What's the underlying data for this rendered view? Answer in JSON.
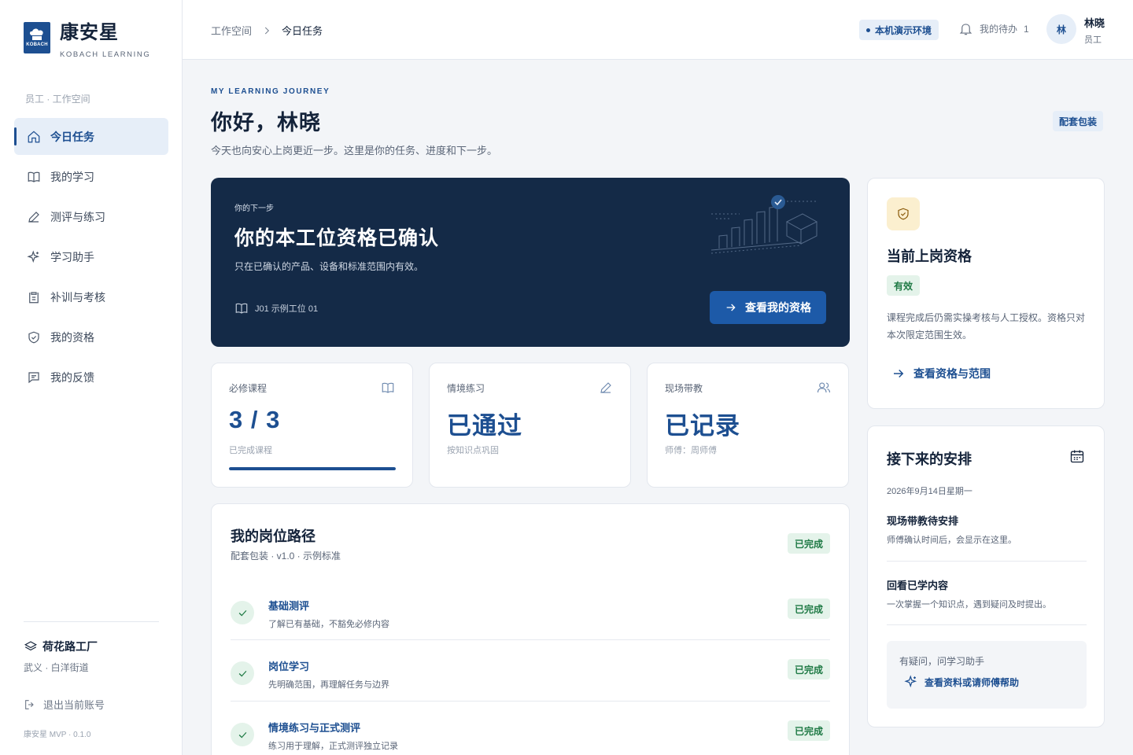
{
  "brand": {
    "title": "康安星",
    "subtitle": "KOBACH LEARNING",
    "logo_text": "KOBACH"
  },
  "sidebar": {
    "role_label": "员工 · 工作空间",
    "items": [
      {
        "label": "今日任务",
        "icon": "home-icon",
        "active": true
      },
      {
        "label": "我的学习",
        "icon": "book-icon"
      },
      {
        "label": "测评与练习",
        "icon": "pencil-icon"
      },
      {
        "label": "学习助手",
        "icon": "sparkle-icon"
      },
      {
        "label": "补训与考核",
        "icon": "clipboard-icon"
      },
      {
        "label": "我的资格",
        "icon": "shield-check-icon"
      },
      {
        "label": "我的反馈",
        "icon": "message-icon"
      }
    ],
    "factory_name": "荷花路工厂",
    "factory_location": "武义 · 白洋街道",
    "logout_label": "退出当前账号",
    "version": "康安星 MVP · 0.1.0"
  },
  "header": {
    "breadcrumb_root": "工作空间",
    "breadcrumb_current": "今日任务",
    "env_badge": "本机演示环境",
    "todo_label": "我的待办",
    "todo_count": "1",
    "avatar_initial": "林",
    "user_name": "林晓",
    "user_role": "员工"
  },
  "greeting": {
    "eyebrow": "MY LEARNING JOURNEY",
    "title": "你好，林晓",
    "subtitle": "今天也向安心上岗更近一步。这里是你的任务、进度和下一步。",
    "package_badge": "配套包装"
  },
  "hero": {
    "eyebrow": "你的下一步",
    "title": "你的本工位资格已确认",
    "subtitle": "只在已确认的产品、设备和标准范围内有效。",
    "station": "J01 示例工位 01",
    "button_label": "查看我的资格"
  },
  "stats": [
    {
      "label": "必修课程",
      "icon": "book-icon",
      "value": "3 / 3",
      "note": "已完成课程",
      "progress": 1.0
    },
    {
      "label": "情境练习",
      "icon": "pencil-icon",
      "value": "已通过",
      "note": "按知识点巩固"
    },
    {
      "label": "现场带教",
      "icon": "users-icon",
      "value": "已记录",
      "note": "师傅：周师傅"
    }
  ],
  "path": {
    "title": "我的岗位路径",
    "subtitle": "配套包装 · v1.0 · 示例标准",
    "status": "已完成",
    "steps": [
      {
        "title": "基础测评",
        "desc": "了解已有基础，不豁免必修内容",
        "status": "已完成"
      },
      {
        "title": "岗位学习",
        "desc": "先明确范围，再理解任务与边界",
        "status": "已完成"
      },
      {
        "title": "情境练习与正式测评",
        "desc": "练习用于理解，正式测评独立记录",
        "status": "已完成"
      }
    ]
  },
  "qualification": {
    "title": "当前上岗资格",
    "status": "有效",
    "desc": "课程完成后仍需实操考核与人工授权。资格只对本次限定范围生效。",
    "link_label": "查看资格与范围"
  },
  "schedule": {
    "title": "接下来的安排",
    "date": "2026年9月14日星期一",
    "items": [
      {
        "title": "现场带教待安排",
        "desc": "师傅确认时间后，会显示在这里。"
      },
      {
        "title": "回看已学内容",
        "desc": "一次掌握一个知识点，遇到疑问及时提出。"
      }
    ],
    "help_question": "有疑问，问学习助手",
    "help_link": "查看资料或请师傅帮助"
  },
  "colors": {
    "primary": "#1d4f91",
    "hero_bg": "#142a47",
    "success": "#1f7a45",
    "success_bg": "#e4f3ea"
  }
}
